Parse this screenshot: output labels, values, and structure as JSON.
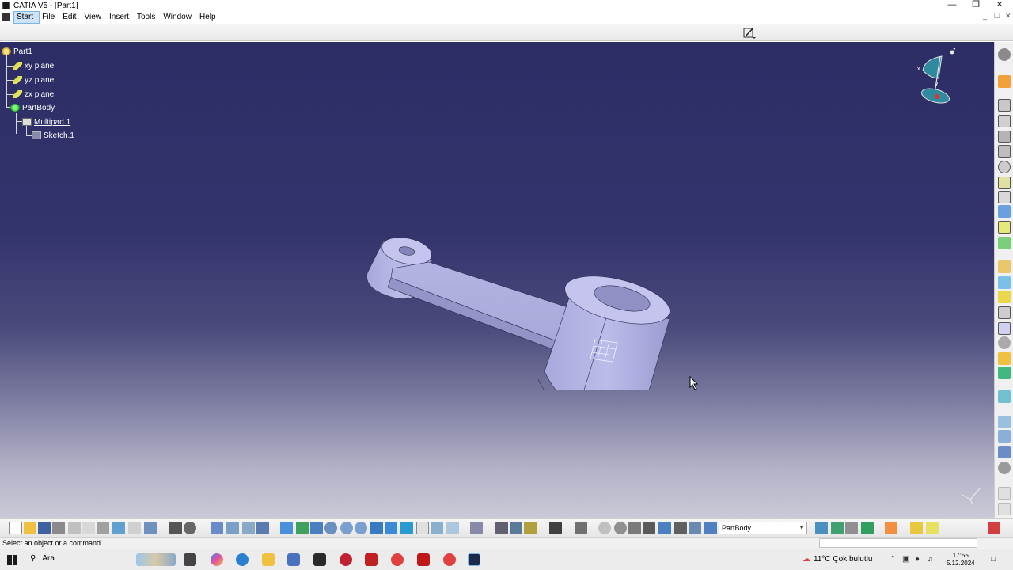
{
  "window": {
    "title": "CATIA V5 - [Part1]"
  },
  "menu": {
    "items": [
      "Start",
      "File",
      "Edit",
      "View",
      "Insert",
      "Tools",
      "Window",
      "Help"
    ]
  },
  "tree": {
    "root": "Part1",
    "planes": [
      "xy plane",
      "yz plane",
      "zx plane"
    ],
    "body": "PartBody",
    "feature": "Multipad.1",
    "sketch": "Sketch.1"
  },
  "compass": {
    "x": "x",
    "y": "y",
    "z": "z"
  },
  "toolbar_bottom": {
    "body_select": "PartBody"
  },
  "statusbar": {
    "message": "Select an object or a command"
  },
  "taskbar": {
    "search": "Ara",
    "weather": "11°C  Çok bulutlu",
    "time": "17:55",
    "date": "5.12.2024"
  },
  "colors": {
    "viewport_top": "#2d2d66",
    "viewport_bottom": "#c9c9d6",
    "part_face": "#b9b9e6",
    "accent": "#7fb5e6"
  }
}
